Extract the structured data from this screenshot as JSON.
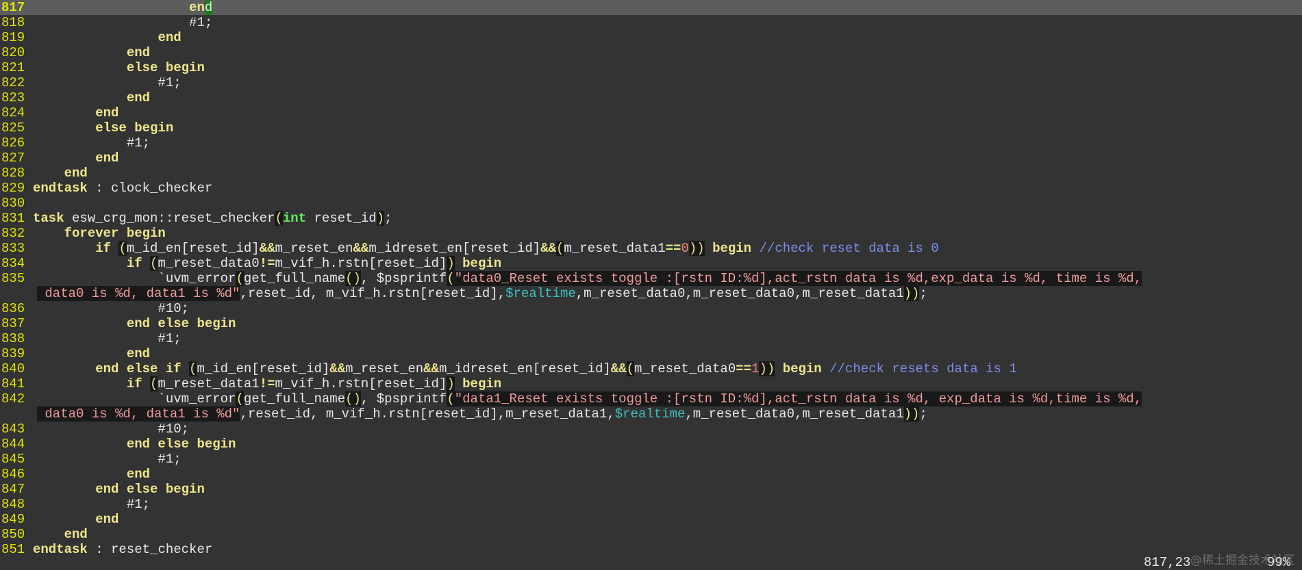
{
  "editor": {
    "lines": [
      {
        "n": "817",
        "current": true,
        "t": [
          [
            "i",
            "                    "
          ],
          [
            "k",
            "en"
          ],
          [
            "cur",
            "d"
          ]
        ]
      },
      {
        "n": "818",
        "t": [
          [
            "i",
            "                    #1;"
          ]
        ]
      },
      {
        "n": "819",
        "t": [
          [
            "i",
            "                "
          ],
          [
            "k",
            "end"
          ]
        ]
      },
      {
        "n": "820",
        "t": [
          [
            "i",
            "            "
          ],
          [
            "k",
            "end"
          ]
        ]
      },
      {
        "n": "821",
        "t": [
          [
            "i",
            "            "
          ],
          [
            "k",
            "else begin"
          ]
        ]
      },
      {
        "n": "822",
        "t": [
          [
            "i",
            "                #1;"
          ]
        ]
      },
      {
        "n": "823",
        "t": [
          [
            "i",
            "            "
          ],
          [
            "k",
            "end"
          ]
        ]
      },
      {
        "n": "824",
        "t": [
          [
            "i",
            "        "
          ],
          [
            "k",
            "end"
          ]
        ]
      },
      {
        "n": "825",
        "t": [
          [
            "i",
            "        "
          ],
          [
            "k",
            "else begin"
          ]
        ]
      },
      {
        "n": "826",
        "t": [
          [
            "i",
            "            #1;"
          ]
        ]
      },
      {
        "n": "827",
        "t": [
          [
            "i",
            "        "
          ],
          [
            "k",
            "end"
          ]
        ]
      },
      {
        "n": "828",
        "t": [
          [
            "i",
            "    "
          ],
          [
            "k",
            "end"
          ]
        ]
      },
      {
        "n": "829",
        "t": [
          [
            "k",
            "endtask"
          ],
          [
            "i",
            " : clock_checker"
          ]
        ]
      },
      {
        "n": "830",
        "t": []
      },
      {
        "n": "831",
        "t": [
          [
            "k",
            "task"
          ],
          [
            "i",
            " esw_crg_mon::reset_checker"
          ],
          [
            "p",
            "("
          ],
          [
            "y",
            "int"
          ],
          [
            "i",
            " reset_id"
          ],
          [
            "p",
            ")"
          ],
          [
            "i",
            ";"
          ]
        ]
      },
      {
        "n": "832",
        "t": [
          [
            "i",
            "    "
          ],
          [
            "k",
            "forever begin"
          ]
        ]
      },
      {
        "n": "833",
        "t": [
          [
            "i",
            "        "
          ],
          [
            "k",
            "if"
          ],
          [
            "i",
            " "
          ],
          [
            "p",
            "("
          ],
          [
            "i",
            "m_id_en[reset_id]"
          ],
          [
            "o",
            "&&"
          ],
          [
            "i",
            "m_reset_en"
          ],
          [
            "o",
            "&&"
          ],
          [
            "i",
            "m_idreset_en[reset_id]"
          ],
          [
            "o",
            "&&"
          ],
          [
            "p",
            "("
          ],
          [
            "i",
            "m_reset_data1"
          ],
          [
            "o",
            "=="
          ],
          [
            "n",
            "0"
          ],
          [
            "p",
            "))"
          ],
          [
            "i",
            " "
          ],
          [
            "k",
            "begin"
          ],
          [
            "i",
            " "
          ],
          [
            "c",
            "//check reset data is 0"
          ]
        ]
      },
      {
        "n": "834",
        "t": [
          [
            "i",
            "            "
          ],
          [
            "k",
            "if"
          ],
          [
            "i",
            " "
          ],
          [
            "p",
            "("
          ],
          [
            "i",
            "m_reset_data0"
          ],
          [
            "o",
            "!="
          ],
          [
            "i",
            "m_vif_h.rstn[reset_id]"
          ],
          [
            "p",
            ")"
          ],
          [
            "i",
            " "
          ],
          [
            "k",
            "begin"
          ]
        ]
      },
      {
        "n": "835",
        "t": [
          [
            "i",
            "                `uvm_error"
          ],
          [
            "p",
            "("
          ],
          [
            "i",
            "get_full_name"
          ],
          [
            "p",
            "()"
          ],
          [
            "i",
            ", $psprintf"
          ],
          [
            "p",
            "("
          ],
          [
            "s",
            "\"data0_Reset exists toggle :[rstn ID:%d],act_rstn data is %d,exp_data is %d, time is %d,"
          ]
        ]
      },
      {
        "n": "",
        "cont": true,
        "t": [
          [
            "s",
            " data0 is %d, data1 is %d\""
          ],
          [
            "i",
            ",reset_id, m_vif_h.rstn[reset_id],"
          ],
          [
            "m",
            "$realtime"
          ],
          [
            "i",
            ",m_reset_data0,m_reset_data0,m_reset_data1"
          ],
          [
            "p",
            "))"
          ],
          [
            "i",
            ";"
          ]
        ]
      },
      {
        "n": "836",
        "t": [
          [
            "i",
            "                #10;"
          ]
        ]
      },
      {
        "n": "837",
        "t": [
          [
            "i",
            "            "
          ],
          [
            "k",
            "end else begin"
          ]
        ]
      },
      {
        "n": "838",
        "t": [
          [
            "i",
            "                #1;"
          ]
        ]
      },
      {
        "n": "839",
        "t": [
          [
            "i",
            "            "
          ],
          [
            "k",
            "end"
          ]
        ]
      },
      {
        "n": "840",
        "t": [
          [
            "i",
            "        "
          ],
          [
            "k",
            "end else if"
          ],
          [
            "i",
            " "
          ],
          [
            "p",
            "("
          ],
          [
            "i",
            "m_id_en[reset_id]"
          ],
          [
            "o",
            "&&"
          ],
          [
            "i",
            "m_reset_en"
          ],
          [
            "o",
            "&&"
          ],
          [
            "i",
            "m_idreset_en[reset_id]"
          ],
          [
            "o",
            "&&"
          ],
          [
            "p",
            "("
          ],
          [
            "i",
            "m_reset_data0"
          ],
          [
            "o",
            "=="
          ],
          [
            "n",
            "1"
          ],
          [
            "p",
            "))"
          ],
          [
            "i",
            " "
          ],
          [
            "k",
            "begin"
          ],
          [
            "i",
            " "
          ],
          [
            "c",
            "//check resets data is 1"
          ]
        ]
      },
      {
        "n": "841",
        "t": [
          [
            "i",
            "            "
          ],
          [
            "k",
            "if"
          ],
          [
            "i",
            " "
          ],
          [
            "p",
            "("
          ],
          [
            "i",
            "m_reset_data1"
          ],
          [
            "o",
            "!="
          ],
          [
            "i",
            "m_vif_h.rstn[reset_id]"
          ],
          [
            "p",
            ")"
          ],
          [
            "i",
            " "
          ],
          [
            "k",
            "begin"
          ]
        ]
      },
      {
        "n": "842",
        "t": [
          [
            "i",
            "                `uvm_error"
          ],
          [
            "p",
            "("
          ],
          [
            "i",
            "get_full_name"
          ],
          [
            "p",
            "()"
          ],
          [
            "i",
            ", $psprintf"
          ],
          [
            "p",
            "("
          ],
          [
            "s",
            "\"data1_Reset exists toggle :[rstn ID:%d],act_rstn data is %d, exp_data is %d,time is %d,"
          ]
        ]
      },
      {
        "n": "",
        "cont": true,
        "t": [
          [
            "s",
            " data0 is %d, data1 is %d\""
          ],
          [
            "i",
            ",reset_id, m_vif_h.rstn[reset_id],m_reset_data1,"
          ],
          [
            "m",
            "$realtime"
          ],
          [
            "i",
            ",m_reset_data0,m_reset_data1"
          ],
          [
            "p",
            "))"
          ],
          [
            "i",
            ";"
          ]
        ]
      },
      {
        "n": "843",
        "t": [
          [
            "i",
            "                #10;"
          ]
        ]
      },
      {
        "n": "844",
        "t": [
          [
            "i",
            "            "
          ],
          [
            "k",
            "end else begin"
          ]
        ]
      },
      {
        "n": "845",
        "t": [
          [
            "i",
            "                #1;"
          ]
        ]
      },
      {
        "n": "846",
        "t": [
          [
            "i",
            "            "
          ],
          [
            "k",
            "end"
          ]
        ]
      },
      {
        "n": "847",
        "t": [
          [
            "i",
            "        "
          ],
          [
            "k",
            "end else begin"
          ]
        ]
      },
      {
        "n": "848",
        "t": [
          [
            "i",
            "            #1;"
          ]
        ]
      },
      {
        "n": "849",
        "t": [
          [
            "i",
            "        "
          ],
          [
            "k",
            "end"
          ]
        ]
      },
      {
        "n": "850",
        "t": [
          [
            "i",
            "    "
          ],
          [
            "k",
            "end"
          ]
        ]
      },
      {
        "n": "851",
        "t": [
          [
            "k",
            "endtask"
          ],
          [
            "i",
            " : reset_checker"
          ]
        ]
      }
    ]
  },
  "statusbar": {
    "position": "817,23",
    "percent": "99%"
  },
  "watermark": "@稀土掘金技术社区",
  "colors": {
    "background": "#333333",
    "line_number": "#e4e400",
    "keyword": "#f0e68c",
    "type": "#5cf05c",
    "string": "#f09a9a",
    "comment": "#7b8ee6",
    "system_task": "#3fc0c0",
    "cursor": "#1f7a1f"
  }
}
